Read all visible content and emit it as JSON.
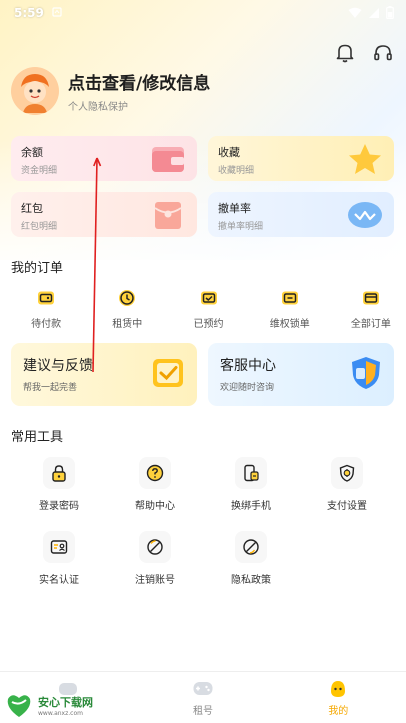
{
  "status_bar": {
    "time": "5:59"
  },
  "profile": {
    "name": "点击查看/修改信息",
    "subtitle": "个人隐私保护"
  },
  "cards": [
    {
      "title": "余额",
      "subtitle": "资金明细"
    },
    {
      "title": "收藏",
      "subtitle": "收藏明细"
    },
    {
      "title": "红包",
      "subtitle": "红包明细"
    },
    {
      "title": "撤单率",
      "subtitle": "撤单率明细"
    }
  ],
  "orders": {
    "title": "我的订单",
    "items": [
      {
        "label": "待付款",
        "icon": "wallet-icon"
      },
      {
        "label": "租赁中",
        "icon": "clock-icon"
      },
      {
        "label": "已预约",
        "icon": "calendar-check-icon"
      },
      {
        "label": "维权锁单",
        "icon": "lock-order-icon"
      },
      {
        "label": "全部订单",
        "icon": "list-icon"
      }
    ]
  },
  "features": [
    {
      "title": "建议与反馈",
      "subtitle": "帮我一起完善"
    },
    {
      "title": "客服中心",
      "subtitle": "欢迎随时咨询"
    }
  ],
  "tools": {
    "title": "常用工具",
    "items": [
      {
        "label": "登录密码",
        "icon": "padlock-icon"
      },
      {
        "label": "帮助中心",
        "icon": "help-icon"
      },
      {
        "label": "换绑手机",
        "icon": "phone-swap-icon"
      },
      {
        "label": "支付设置",
        "icon": "payment-shield-icon"
      },
      {
        "label": "实名认证",
        "icon": "id-card-icon"
      },
      {
        "label": "注销账号",
        "icon": "cancel-account-icon"
      },
      {
        "label": "隐私政策",
        "icon": "privacy-icon"
      }
    ]
  },
  "bottom_nav": {
    "items": [
      {
        "label": "",
        "icon": "home-icon"
      },
      {
        "label": "租号",
        "icon": "gamepad-icon"
      },
      {
        "label": "我的",
        "icon": "profile-face-icon",
        "active": true
      }
    ]
  },
  "watermark": {
    "title": "安心下载网",
    "url": "www.anxz.com"
  },
  "colors": {
    "accent": "#f5a800",
    "annotation": "#e02020"
  }
}
